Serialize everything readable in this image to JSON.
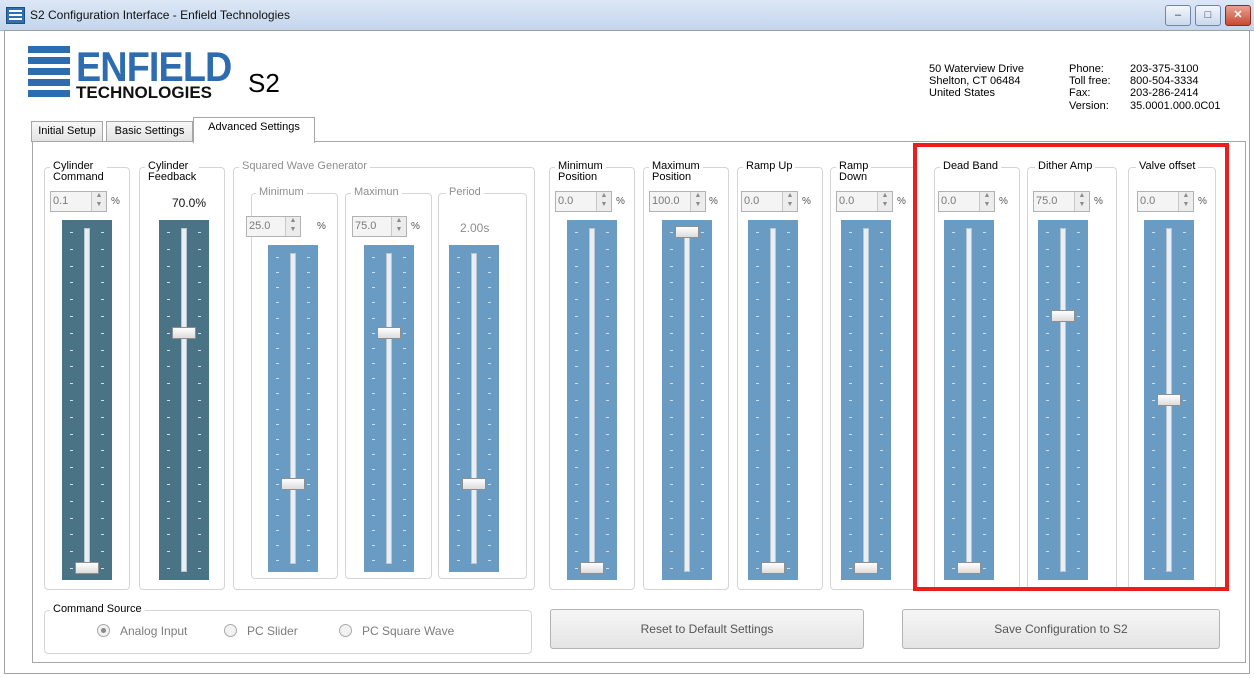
{
  "window": {
    "title": "S2 Configuration Interface - Enfield Technologies",
    "minimize_glyph": "–",
    "maximize_glyph": "□",
    "close_glyph": "✕"
  },
  "header": {
    "logo_main": "ENFIELD",
    "logo_sub": "TECHNOLOGIES",
    "model": "S2",
    "address": [
      "50 Waterview Drive",
      "Shelton, CT 06484",
      "United States"
    ],
    "contact_labels": [
      "Phone:",
      "Toll free:",
      "Fax:",
      "Version:"
    ],
    "contact_values": [
      "203-375-3100",
      "800-504-3334",
      "203-286-2414",
      "35.0001.000.0C01"
    ]
  },
  "tabs": [
    {
      "label": "Initial Setup"
    },
    {
      "label": "Basic Settings"
    },
    {
      "label": "Advanced Settings"
    }
  ],
  "sliders": {
    "cylinder_command": {
      "label": "Cylinder\nCommand",
      "value": "0.1",
      "unit": "%",
      "level": 0.001
    },
    "cylinder_feedback": {
      "label": "Cylinder\nFeedback",
      "readout": "70.0%",
      "level": 0.7
    },
    "square_wave": {
      "title": "Squared Wave Generator",
      "minimum": {
        "label": "Minimum",
        "value": "25.0",
        "unit": "%",
        "level": 0.25
      },
      "maximum": {
        "label": "Maximun",
        "value": "75.0",
        "unit": "%",
        "level": 0.75
      },
      "period": {
        "label": "Period",
        "readout": "2.00s",
        "level": 0.25
      }
    },
    "minimum_position": {
      "label": "Minimum\nPosition",
      "value": "0.0",
      "unit": "%",
      "level": 0.0
    },
    "maximum_position": {
      "label": "Maximum\nPosition",
      "value": "100.0",
      "unit": "%",
      "level": 1.0
    },
    "ramp_up": {
      "label": "Ramp Up",
      "value": "0.0",
      "unit": "%",
      "level": 0.0
    },
    "ramp_down": {
      "label": "Ramp\nDown",
      "value": "0.0",
      "unit": "%",
      "level": 0.0
    },
    "dead_band": {
      "label": "Dead Band",
      "value": "0.0",
      "unit": "%",
      "level": 0.0
    },
    "dither_amp": {
      "label": "Dither Amp",
      "value": "75.0",
      "unit": "%",
      "level": 0.75
    },
    "valve_offset": {
      "label": "Valve offset",
      "value": "0.0",
      "unit": "%",
      "level": 0.5
    }
  },
  "command_source": {
    "title": "Command Source",
    "options": [
      {
        "label": "Analog Input",
        "selected": true
      },
      {
        "label": "PC Slider",
        "selected": false
      },
      {
        "label": "PC Square Wave",
        "selected": false
      }
    ]
  },
  "buttons": {
    "reset": "Reset to Default Settings",
    "save": "Save Configuration to S2"
  },
  "colors": {
    "slider_track": "#6a9cc3",
    "slider_track_dark": "#4a7386",
    "highlight_box": "#ee1c1c",
    "brand_blue": "#2e6cb0"
  }
}
